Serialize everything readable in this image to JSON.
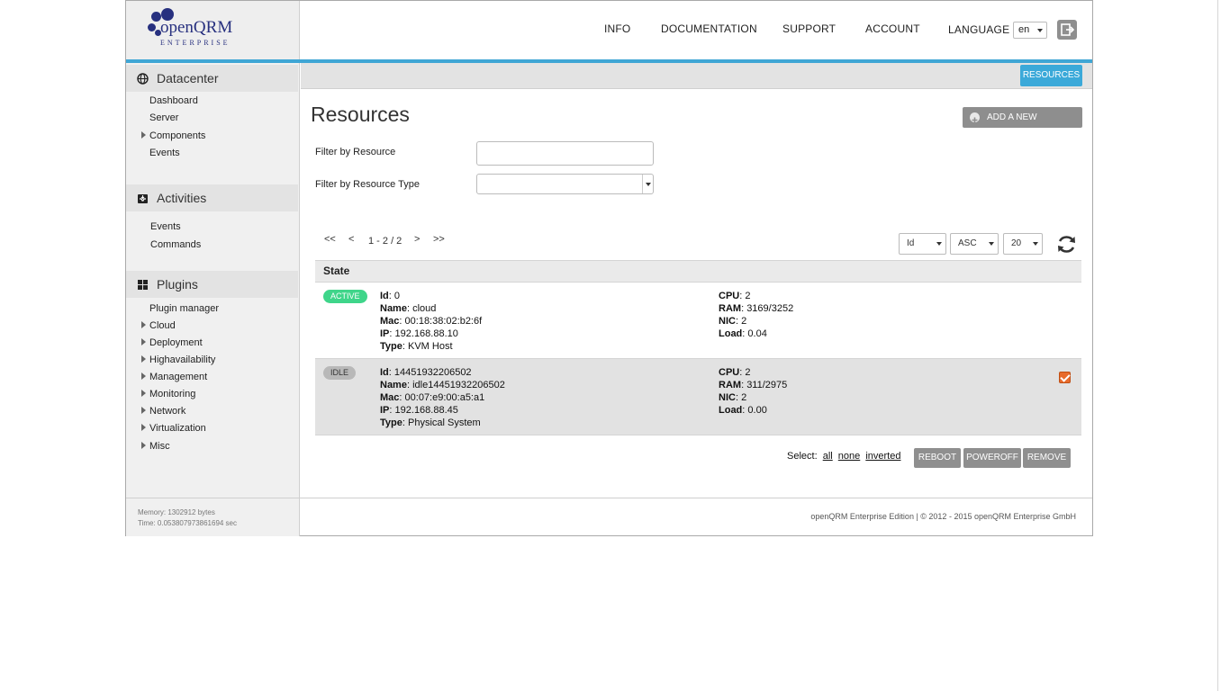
{
  "brand": {
    "name": "openQRM",
    "tagline": "ENTERPRISE"
  },
  "topnav": {
    "info": "INFO",
    "documentation": "DOCUMENTATION",
    "support": "SUPPORT",
    "account": "ACCOUNT",
    "language_label": "LANGUAGE",
    "language_value": "en"
  },
  "subbar": {
    "resources_button": "RESOURCES"
  },
  "sidebar": {
    "datacenter": {
      "title": "Datacenter",
      "items": [
        "Dashboard",
        "Server",
        "Components",
        "Events"
      ]
    },
    "activities": {
      "title": "Activities",
      "items": [
        "Events",
        "Commands"
      ]
    },
    "plugins": {
      "title": "Plugins",
      "items": [
        "Plugin manager",
        "Cloud",
        "Deployment",
        "Highavailability",
        "Management",
        "Monitoring",
        "Network",
        "Virtualization",
        "Misc"
      ]
    }
  },
  "main": {
    "title": "Resources",
    "add_button": "ADD A NEW RESOURCE",
    "filter_resource_label": "Filter by Resource",
    "filter_type_label": "Filter by Resource Type",
    "pager": {
      "first": "<<",
      "prev": "<",
      "range": "1 - 2 / 2",
      "next": ">",
      "last": ">>"
    },
    "sort_field": "Id",
    "sort_order": "ASC",
    "page_size": "20",
    "table_header": "State",
    "rows": [
      {
        "state": "ACTIVE",
        "id": "0",
        "name": "cloud",
        "mac": "00:18:38:02:b2:6f",
        "ip": "192.168.88.10",
        "type": "KVM Host",
        "cpu": "2",
        "ram": "3169/3252",
        "nic": "2",
        "load": "0.04"
      },
      {
        "state": "IDLE",
        "id": "14451932206502",
        "name": "idle14451932206502",
        "mac": "00:07:e9:00:a5:a1",
        "ip": "192.168.88.45",
        "type": "Physical System",
        "cpu": "2",
        "ram": "311/2975",
        "nic": "2",
        "load": "0.00"
      }
    ],
    "select_label": "Select:",
    "select_all": "all",
    "select_none": "none",
    "select_inverted": "inverted",
    "actions": {
      "reboot": "REBOOT",
      "poweroff": "POWEROFF",
      "remove": "REMOVE"
    }
  },
  "footer": {
    "memory": "Memory: 1302912 bytes",
    "time": "Time: 0.053807973861694 sec",
    "copyright": "openQRM Enterprise Edition | © 2012 - 2015 openQRM Enterprise GmbH"
  },
  "labels": {
    "id": "Id",
    "name": "Name",
    "mac": "Mac",
    "ip": "IP",
    "type": "Type",
    "cpu": "CPU",
    "ram": "RAM",
    "nic": "NIC",
    "load": "Load"
  },
  "colors": {
    "accent": "#3fa6d5",
    "active": "#3fd58a",
    "checkbox": "#e86b2c",
    "brand": "#27307f"
  }
}
